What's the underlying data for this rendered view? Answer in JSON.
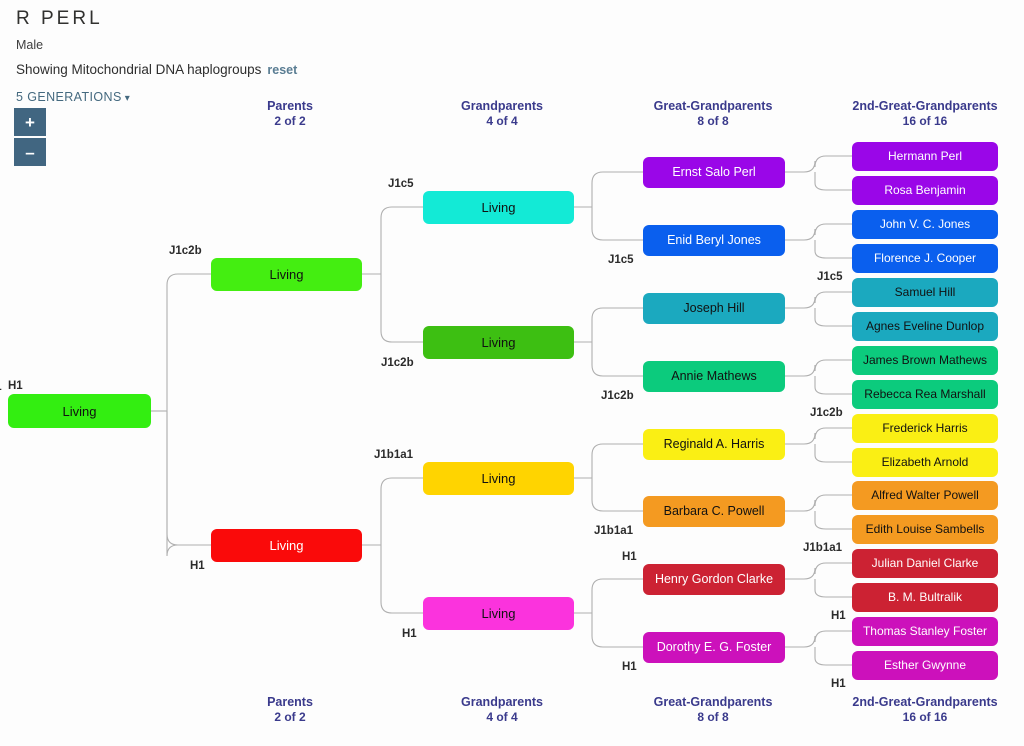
{
  "header": {
    "person_name": "R PERL",
    "sex": "Male",
    "showing_text": "Showing Mitochondrial DNA haplogroups",
    "reset_label": "reset",
    "generations_label": "5 GENERATIONS",
    "zoom_in_label": "+",
    "zoom_out_label": "–"
  },
  "columns": [
    {
      "title": "Parents",
      "count": "2 of 2"
    },
    {
      "title": "Grandparents",
      "count": "4 of 4"
    },
    {
      "title": "Great-Grandparents",
      "count": "8 of 8"
    },
    {
      "title": "2nd-Great-Grandparents",
      "count": "16 of 16"
    }
  ],
  "root": {
    "label": "Living",
    "haplogroup": "H1",
    "color": "#33ee11",
    "text_tone": "light"
  },
  "parents": [
    {
      "label": "Living",
      "haplogroup": "J1c2b",
      "color": "#44ee11",
      "text_tone": "light"
    },
    {
      "label": "Living",
      "haplogroup": "H1",
      "color": "#fa0a0a",
      "text_tone": "dark"
    }
  ],
  "grandparents": [
    {
      "label": "Living",
      "haplogroup": "J1c5",
      "color": "#13ead6",
      "text_tone": "light"
    },
    {
      "label": "Living",
      "haplogroup": "J1c2b",
      "color": "#3dbf12",
      "text_tone": "light"
    },
    {
      "label": "Living",
      "haplogroup": "J1b1a1",
      "color": "#ffd400",
      "text_tone": "light"
    },
    {
      "label": "Living",
      "haplogroup": "H1",
      "color": "#fb33dd",
      "text_tone": "light"
    }
  ],
  "great_grandparents": [
    {
      "label": "Ernst Salo Perl",
      "color": "#9a06e8",
      "text_tone": "dark"
    },
    {
      "label": "Enid Beryl Jones",
      "haplogroup": "J1c5",
      "color": "#0a5fee",
      "text_tone": "dark"
    },
    {
      "label": "Joseph Hill",
      "color": "#1ba9bf",
      "text_tone": "light"
    },
    {
      "label": "Annie Mathews",
      "haplogroup": "J1c2b",
      "color": "#0ccb7d",
      "text_tone": "light"
    },
    {
      "label": "Reginald A. Harris",
      "color": "#faef14",
      "text_tone": "light"
    },
    {
      "label": "Barbara C. Powell",
      "haplogroup": "J1b1a1",
      "color": "#f49a21",
      "text_tone": "light"
    },
    {
      "label": "Henry Gordon Clarke",
      "haplogroup": "H1",
      "color": "#cc2233",
      "text_tone": "dark"
    },
    {
      "label": "Dorothy E. G. Foster",
      "haplogroup": "H1",
      "color": "#cc11bb",
      "text_tone": "dark"
    }
  ],
  "second_great_grandparents": [
    {
      "label": "Hermann Perl",
      "color": "#9a06e8",
      "text_tone": "dark"
    },
    {
      "label": "Rosa Benjamin",
      "color": "#9a06e8",
      "text_tone": "dark"
    },
    {
      "label": "John V. C. Jones",
      "color": "#0a5fee",
      "text_tone": "dark"
    },
    {
      "label": "Florence J. Cooper",
      "haplogroup": "J1c5",
      "color": "#0a5fee",
      "text_tone": "dark"
    },
    {
      "label": "Samuel Hill",
      "color": "#1ba9bf",
      "text_tone": "light"
    },
    {
      "label": "Agnes Eveline Dunlop",
      "color": "#1ba9bf",
      "text_tone": "light"
    },
    {
      "label": "James Brown Mathews",
      "color": "#0ccb7d",
      "text_tone": "light"
    },
    {
      "label": "Rebecca Rea Marshall",
      "haplogroup": "J1c2b",
      "color": "#0ccb7d",
      "text_tone": "light"
    },
    {
      "label": "Frederick Harris",
      "color": "#faef14",
      "text_tone": "light"
    },
    {
      "label": "Elizabeth Arnold",
      "color": "#faef14",
      "text_tone": "light"
    },
    {
      "label": "Alfred Walter Powell",
      "color": "#f49a21",
      "text_tone": "light"
    },
    {
      "label": "Edith Louise Sambells",
      "haplogroup": "J1b1a1",
      "color": "#f49a21",
      "text_tone": "light"
    },
    {
      "label": "Julian Daniel Clarke",
      "color": "#cc2233",
      "text_tone": "dark"
    },
    {
      "label": "B. M. Bultralik",
      "haplogroup": "H1",
      "color": "#cc2233",
      "text_tone": "dark"
    },
    {
      "label": "Thomas Stanley Foster",
      "color": "#cc11bb",
      "text_tone": "dark"
    },
    {
      "label": "Esther Gwynne",
      "haplogroup": "H1",
      "color": "#cc11bb",
      "text_tone": "dark"
    }
  ]
}
